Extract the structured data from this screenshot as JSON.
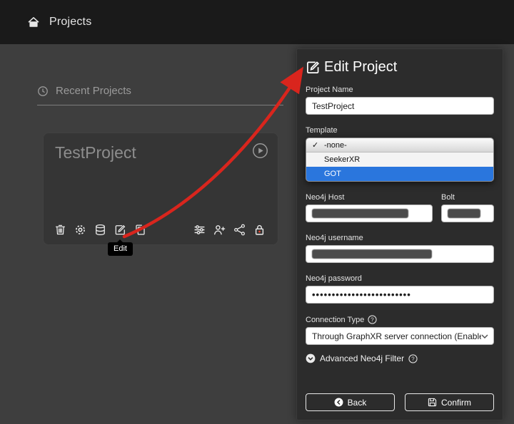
{
  "nav": {
    "title": "Projects"
  },
  "main": {
    "section_title": "Recent Projects",
    "card": {
      "name": "TestProject",
      "tooltip": "Edit"
    }
  },
  "panel": {
    "title": "Edit Project",
    "project_name": {
      "label": "Project Name",
      "value": "TestProject"
    },
    "template": {
      "label": "Template",
      "selected": "-none-",
      "options": [
        "-none-",
        "SeekerXR",
        "GOT"
      ],
      "highlighted": "GOT",
      "check": "✓"
    },
    "neo4j_host": {
      "label": "Neo4j Host"
    },
    "bolt": {
      "label": "Bolt"
    },
    "neo4j_username": {
      "label": "Neo4j username"
    },
    "neo4j_password": {
      "label": "Neo4j password",
      "value": "•••••••••••••••••••••••••"
    },
    "connection_type": {
      "label": "Connection Type",
      "value": "Through GraphXR server connection (Enables project sha"
    },
    "advanced_filter": {
      "label": "Advanced Neo4j Filter"
    },
    "buttons": {
      "back": "Back",
      "confirm": "Confirm"
    }
  },
  "colors": {
    "highlight_blue": "#2a76dd",
    "arrow_red": "#d9251d"
  }
}
